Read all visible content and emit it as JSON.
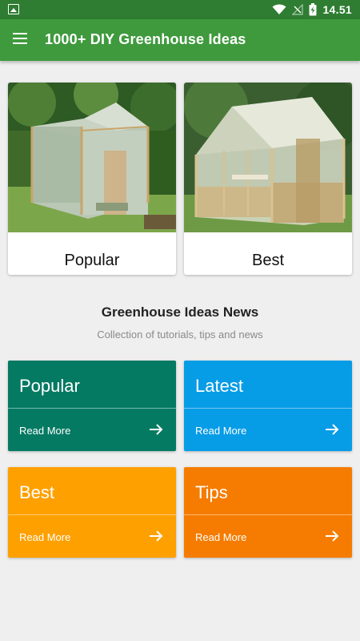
{
  "status_bar": {
    "time": "14.51",
    "icons": [
      "gallery-icon",
      "wifi-icon",
      "no-signal-icon",
      "battery-charging-icon"
    ]
  },
  "app_bar": {
    "title": "1000+ DIY Greenhouse Ideas",
    "menu_icon": "hamburger-menu-icon"
  },
  "featured": [
    {
      "label": "Popular",
      "image": "plastic-bottle-greenhouse-photo"
    },
    {
      "label": "Best",
      "image": "wooden-glass-greenhouse-photo"
    }
  ],
  "news": {
    "title": "Greenhouse Ideas News",
    "subtitle": "Collection of tutorials, tips and news"
  },
  "tiles": [
    {
      "title": "Popular",
      "action": "Read More",
      "color": "#057a63"
    },
    {
      "title": "Latest",
      "action": "Read More",
      "color": "#079ce6"
    },
    {
      "title": "Best",
      "action": "Read More",
      "color": "#fea000"
    },
    {
      "title": "Tips",
      "action": "Read More",
      "color": "#f57c00"
    }
  ],
  "colors": {
    "status_bar": "#2e7d32",
    "app_bar": "#3f9a3d",
    "background": "#efefef"
  }
}
